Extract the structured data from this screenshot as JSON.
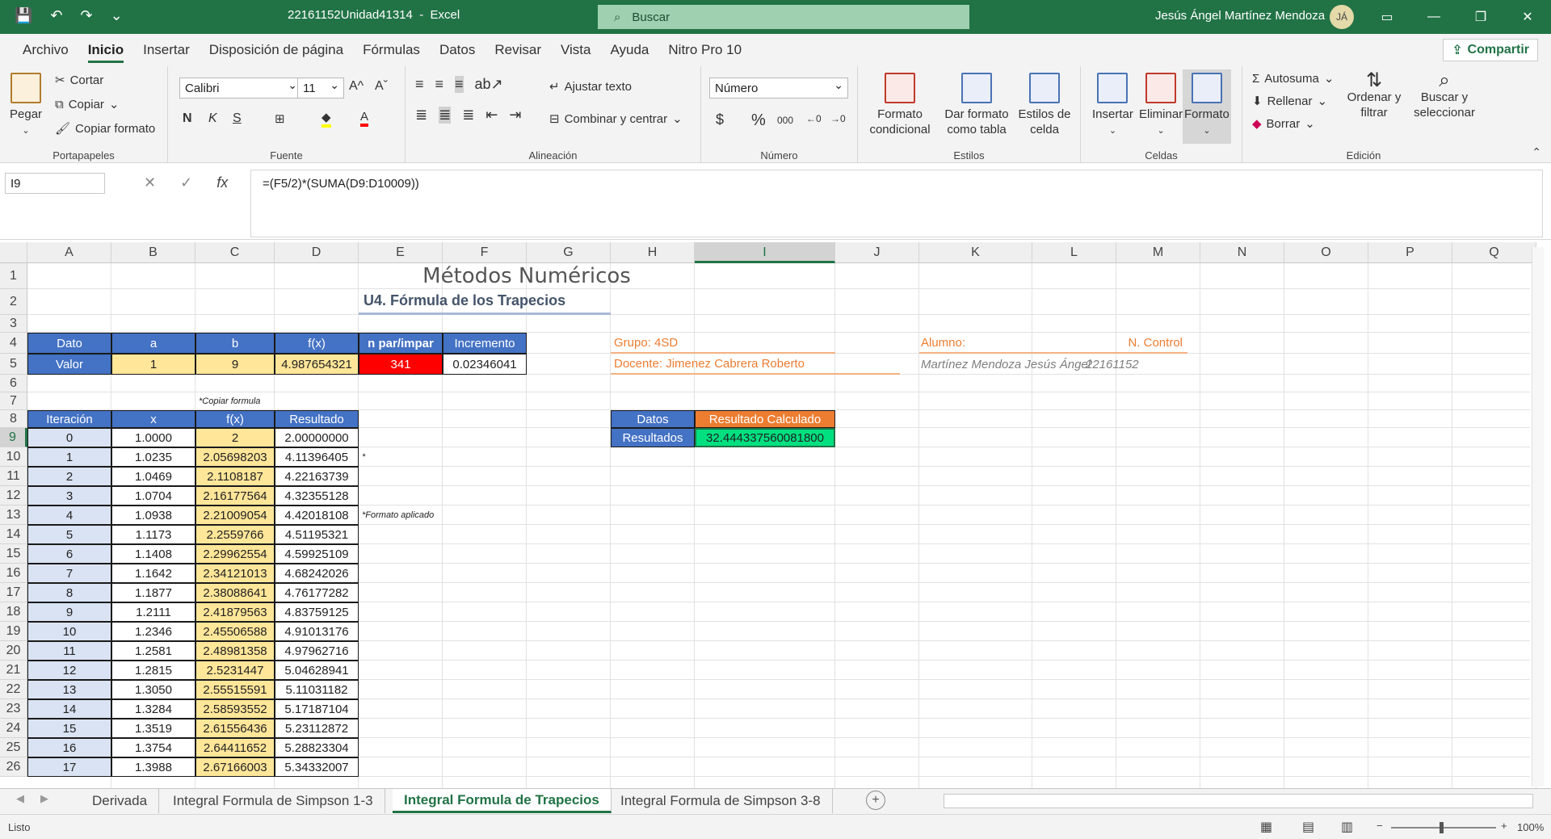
{
  "window": {
    "title": "22161152Unidad41314  -  Excel",
    "search_placeholder": "Buscar",
    "user": "Jesús Ángel Martínez Mendoza",
    "avatar_initials": "JÁ"
  },
  "menu": [
    "Archivo",
    "Inicio",
    "Insertar",
    "Disposición de página",
    "Fórmulas",
    "Datos",
    "Revisar",
    "Vista",
    "Ayuda",
    "Nitro Pro 10"
  ],
  "share_label": "Compartir",
  "ribbon": {
    "clipboard": {
      "paste": "Pegar",
      "cut": "Cortar",
      "copy": "Copiar",
      "format_painter": "Copiar formato",
      "label": "Portapapeles"
    },
    "font": {
      "name": "Calibri",
      "size": "11",
      "bold": "N",
      "italic": "K",
      "underline": "S",
      "label": "Fuente"
    },
    "alignment": {
      "wrap": "Ajustar texto",
      "merge": "Combinar y centrar",
      "label": "Alineación"
    },
    "number": {
      "format": "Número",
      "currency": "$",
      "percent": "%",
      "thousands": "000",
      "label": "Número"
    },
    "styles": {
      "conditional": "Formato condicional",
      "as_table": "Dar formato como tabla",
      "cell_styles": "Estilos de celda",
      "label": "Estilos"
    },
    "cells": {
      "insert": "Insertar",
      "delete": "Eliminar",
      "format": "Formato",
      "label": "Celdas"
    },
    "editing": {
      "autosum": "Autosuma",
      "fill": "Rellenar",
      "clear": "Borrar",
      "sort": "Ordenar y filtrar",
      "find": "Buscar y seleccionar",
      "label": "Edición"
    }
  },
  "formula_bar": {
    "name_box": "I9",
    "formula": "=(F5/2)*(SUMA(D9:D10009))"
  },
  "columns": [
    "A",
    "B",
    "C",
    "D",
    "E",
    "F",
    "G",
    "H",
    "I",
    "J",
    "K",
    "L",
    "M",
    "N",
    "O",
    "P",
    "Q"
  ],
  "rows": [
    "1",
    "2",
    "3",
    "4",
    "5",
    "6",
    "7",
    "8",
    "9",
    "10",
    "11",
    "12",
    "13",
    "14",
    "15",
    "16",
    "17",
    "18",
    "19",
    "20",
    "21",
    "22",
    "23",
    "24",
    "25",
    "26"
  ],
  "sheet": {
    "title": "Métodos Numéricos",
    "subtitle": "U4. Fórmula de los Trapecios",
    "params_headers": [
      "Dato",
      "a",
      "b",
      "f(x)",
      "n par/impar",
      "Incremento"
    ],
    "params_values": [
      "Valor",
      "1",
      "9",
      "4.987654321",
      "341",
      "0.02346041"
    ],
    "group": "Grupo: 4SD",
    "teacher": "Docente: Jimenez Cabrera Roberto",
    "student_label": "Alumno:",
    "control_label": "N. Control",
    "student_name": "Martínez Mendoza Jesús Ángel",
    "control_number": "22161152",
    "note_copy": "*Copiar formula",
    "note_star": "*",
    "note_format": "*Formato aplicado",
    "table_headers": [
      "Iteración",
      "x",
      "f(x)",
      "Resultado"
    ],
    "table_rows": [
      [
        "0",
        "1.0000",
        "2",
        "2.00000000"
      ],
      [
        "1",
        "1.0235",
        "2.05698203",
        "4.11396405"
      ],
      [
        "2",
        "1.0469",
        "2.1108187",
        "4.22163739"
      ],
      [
        "3",
        "1.0704",
        "2.16177564",
        "4.32355128"
      ],
      [
        "4",
        "1.0938",
        "2.21009054",
        "4.42018108"
      ],
      [
        "5",
        "1.1173",
        "2.2559766",
        "4.51195321"
      ],
      [
        "6",
        "1.1408",
        "2.29962554",
        "4.59925109"
      ],
      [
        "7",
        "1.1642",
        "2.34121013",
        "4.68242026"
      ],
      [
        "8",
        "1.1877",
        "2.38088641",
        "4.76177282"
      ],
      [
        "9",
        "1.2111",
        "2.41879563",
        "4.83759125"
      ],
      [
        "10",
        "1.2346",
        "2.45506588",
        "4.91013176"
      ],
      [
        "11",
        "1.2581",
        "2.48981358",
        "4.97962716"
      ],
      [
        "12",
        "1.2815",
        "2.5231447",
        "5.04628941"
      ],
      [
        "13",
        "1.3050",
        "2.55515591",
        "5.11031182"
      ],
      [
        "14",
        "1.3284",
        "2.58593552",
        "5.17187104"
      ],
      [
        "15",
        "1.3519",
        "2.61556436",
        "5.23112872"
      ],
      [
        "16",
        "1.3754",
        "2.64411652",
        "5.28823304"
      ],
      [
        "17",
        "1.3988",
        "2.67166003",
        "5.34332007"
      ]
    ],
    "result_headers": [
      "Datos",
      "Resultado Calculado"
    ],
    "result_values": [
      "Resultados",
      "32.444337560081800"
    ]
  },
  "sheet_tabs": [
    "Derivada",
    "Integral Formula de Simpson 1-3",
    "Integral Formula de Trapecios",
    "Integral Formula de Simpson 3-8"
  ],
  "active_sheet_index": 2,
  "status": {
    "text": "Listo",
    "zoom": "100%"
  },
  "colors": {
    "excel_green": "#217346",
    "header_blue": "#4472c4",
    "pale_blue": "#dae3f3",
    "yellow": "#ffe699",
    "orange": "#ed7d31",
    "red": "#ff0000",
    "result_green": "#00e080"
  }
}
